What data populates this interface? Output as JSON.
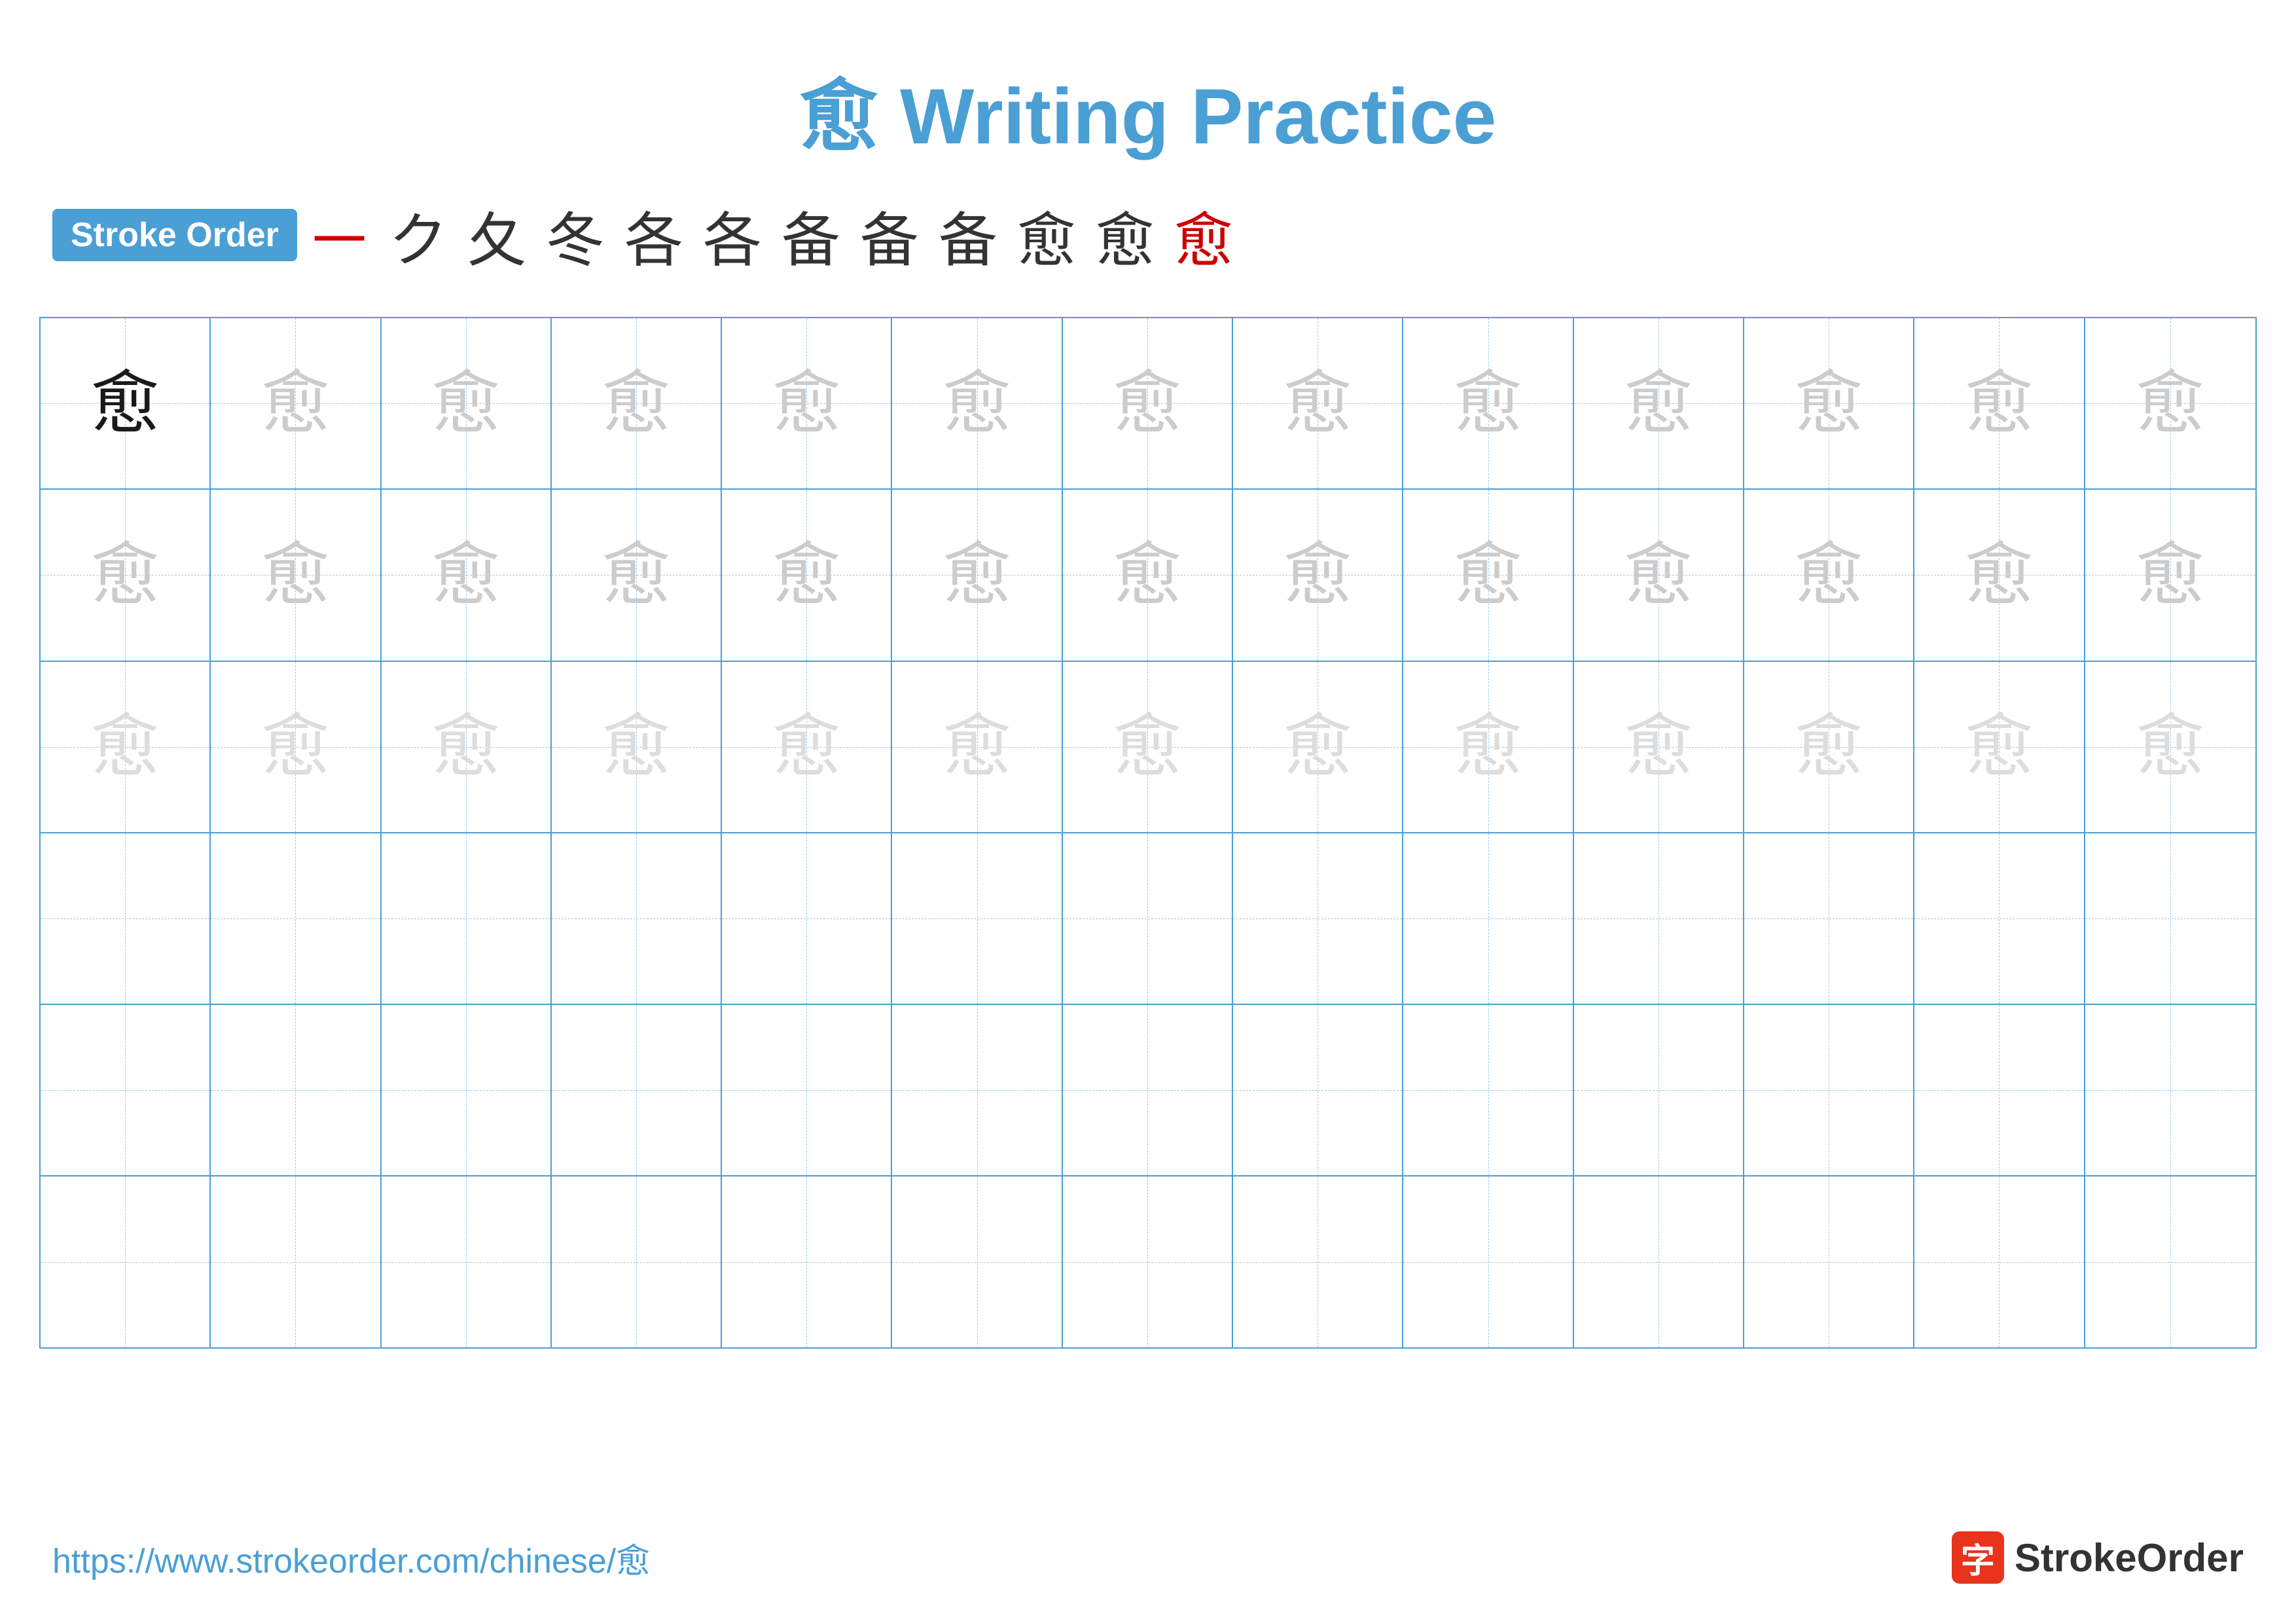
{
  "title": {
    "char": "愈",
    "text": " Writing Practice"
  },
  "stroke_order": {
    "badge_label": "Stroke Order",
    "strokes": [
      "㇐",
      "ク",
      "夂",
      "冬",
      "各",
      "各",
      "备",
      "备",
      "备",
      "愈",
      "愈",
      "愈"
    ]
  },
  "grid": {
    "rows": 6,
    "cols": 13,
    "character": "愈",
    "row_types": [
      "dark_then_light",
      "light",
      "lighter",
      "empty",
      "empty",
      "empty"
    ]
  },
  "footer": {
    "url": "https://www.strokeorder.com/chinese/愈",
    "logo_text": "StrokeOrder",
    "logo_icon": "字"
  }
}
